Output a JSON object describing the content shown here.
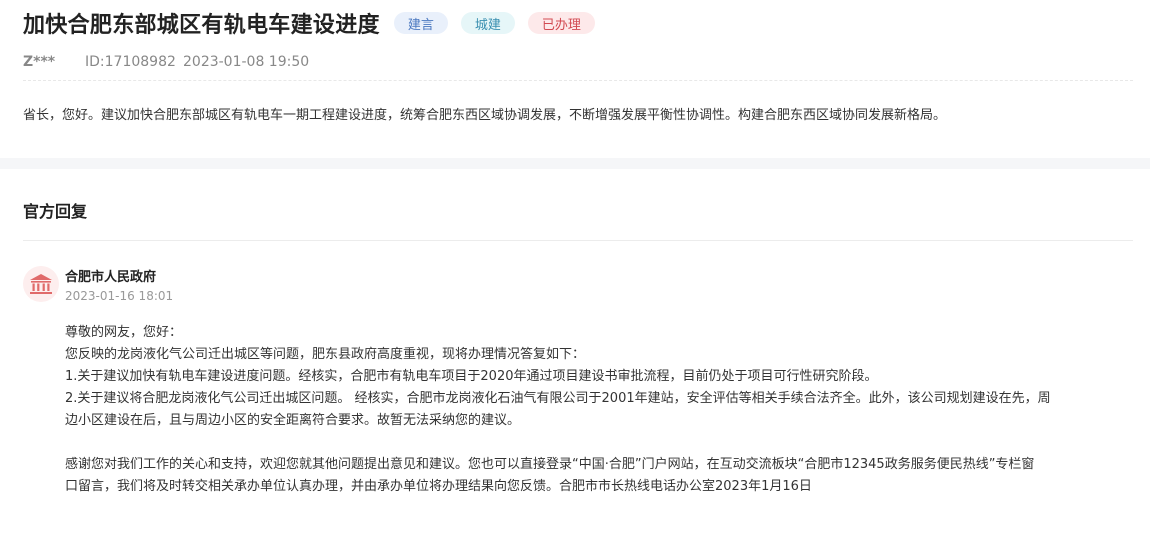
{
  "question": {
    "title": "加快合肥东部城区有轨电车建设进度",
    "tags": [
      "建言",
      "城建",
      "已办理"
    ],
    "user": "Z***",
    "id_label": "ID:17108982",
    "datetime": "2023-01-08 19:50",
    "content": "省长，您好。建议加快合肥东部城区有轨电车一期工程建设进度，统筹合肥东西区域协调发展，不断增强发展平衡性协调性。构建合肥东西区域协同发展新格局。"
  },
  "reply": {
    "heading": "官方回复",
    "org_name": "合肥市人民政府",
    "org_icon": "government-building-icon",
    "datetime": "2023-01-16 18:01",
    "greeting": "尊敬的网友，您好：",
    "intro": "您反映的龙岗液化气公司迁出城区等问题，肥东县政府高度重视，现将办理情况答复如下：",
    "point1": "1.关于建议加快有轨电车建设进度问题。经核实，合肥市有轨电车项目于2020年通过项目建设书审批流程，目前仍处于项目可行性研究阶段。",
    "point2_line1": "2.关于建议将合肥龙岗液化气公司迁出城区问题。 经核实，合肥市龙岗液化石油气有限公司于2001年建站，安全评估等相关手续合法齐全。此外，该公司规划建设在先，周",
    "point2_line2": "边小区建设在后，且与周边小区的安全距离符合要求。故暂无法采纳您的建议。",
    "closing_line1": "感谢您对我们工作的关心和支持，欢迎您就其他问题提出意见和建议。您也可以直接登录“中国·合肥”门户网站，在互动交流板块“合肥市12345政务服务便民热线”专栏窗",
    "closing_line2": "口留言，我们将及时转交相关承办单位认真办理，并由承办单位将办理结果向您反馈。合肥市市长热线电话办公室2023年1月16日"
  },
  "colors": {
    "tag_blue": "#4a78c0",
    "tag_cyan": "#3a8fb0",
    "tag_red": "#d24a52",
    "avatar_icon": "#e06a6a"
  }
}
